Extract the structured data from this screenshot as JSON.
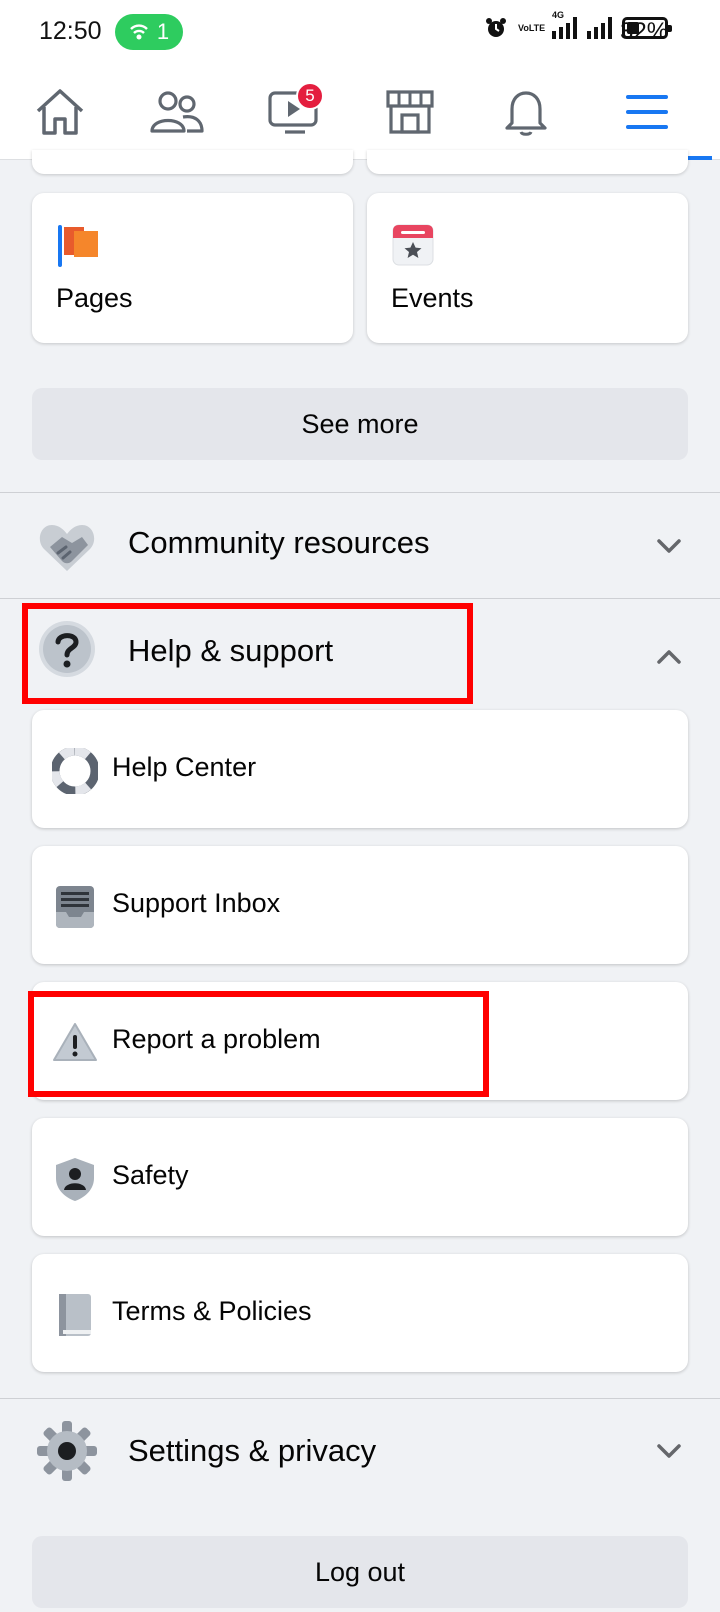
{
  "status_bar": {
    "time": "12:50",
    "hotspot_count": "1",
    "network_label": "4G",
    "volte_label": "VoLTE",
    "battery_percent": "32%",
    "battery_level": 0.32
  },
  "nav": {
    "tabs": [
      {
        "name": "home",
        "icon": "home-icon"
      },
      {
        "name": "friends",
        "icon": "friends-icon"
      },
      {
        "name": "watch",
        "icon": "video-icon",
        "badge": "5"
      },
      {
        "name": "marketplace",
        "icon": "store-icon"
      },
      {
        "name": "notifications",
        "icon": "bell-icon"
      },
      {
        "name": "menu",
        "icon": "hamburger-icon",
        "active": true
      }
    ]
  },
  "shortcuts": [
    {
      "label": "Pages",
      "icon": "flag-icon"
    },
    {
      "label": "Events",
      "icon": "calendar-star-icon"
    }
  ],
  "see_more_label": "See more",
  "sections": {
    "community": {
      "label": "Community resources",
      "icon": "handshake-heart-icon",
      "expanded": false
    },
    "help": {
      "label": "Help & support",
      "icon": "question-circle-icon",
      "expanded": true
    },
    "settings": {
      "label": "Settings & privacy",
      "icon": "gear-icon",
      "expanded": false
    }
  },
  "help_items": [
    {
      "label": "Help Center",
      "icon": "lifebuoy-icon"
    },
    {
      "label": "Support Inbox",
      "icon": "inbox-tray-icon"
    },
    {
      "label": "Report a problem",
      "icon": "warning-triangle-icon"
    },
    {
      "label": "Safety",
      "icon": "shield-person-icon"
    },
    {
      "label": "Terms & Policies",
      "icon": "book-icon"
    }
  ],
  "logout_label": "Log out",
  "colors": {
    "accent": "#1877f2",
    "highlight": "#ff0000",
    "badge": "#e41e3f",
    "hotspot": "#2ecc5f",
    "background": "#f0f2f5"
  }
}
